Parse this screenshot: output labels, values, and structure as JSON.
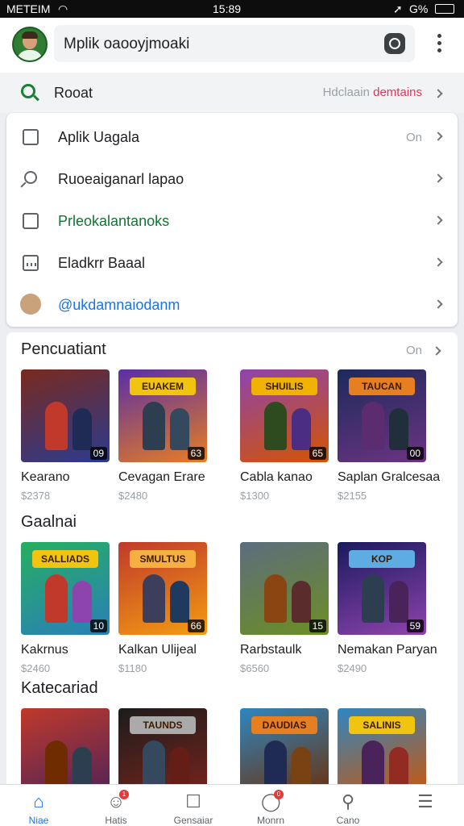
{
  "status_bar": {
    "carrier": "METEIM",
    "time": "15:89",
    "battery": "G%"
  },
  "app_bar": {
    "search_text": "Mplik oaooyjmoaki"
  },
  "recent": {
    "label": "Rooat",
    "side_gray": "Hdclaain",
    "side_red": "demtains"
  },
  "menu": [
    {
      "label": "Aplik Uagala",
      "side": "On",
      "icon": "apps-icon",
      "color": "#202124"
    },
    {
      "label": "Ruoeaiganarl lapao",
      "side": "",
      "icon": "search-icon",
      "color": "#202124"
    },
    {
      "label": "Prleokalantanoks",
      "side": "",
      "icon": "download-icon",
      "color": "#137333"
    },
    {
      "label": "Eladkrr Baaal",
      "side": "",
      "icon": "calendar-icon",
      "color": "#202124"
    },
    {
      "label": "@ukdamnaiodanm",
      "side": "",
      "icon": "person-icon",
      "color": "#1a73e8"
    }
  ],
  "sections": [
    {
      "title": "Pencuatiant",
      "more": "On",
      "cards": [
        {
          "name": "Kearano",
          "price": "$2378",
          "rating": "09",
          "banner": "",
          "bg": "#7a2a1f",
          "bg2": "#2b3b8f",
          "hero": "#c0392b",
          "hero2": "#1f2a55",
          "banner_color": "#e0a020"
        },
        {
          "name": "Cevagan Erare",
          "price": "$2480",
          "rating": "63",
          "banner": "EUAKEM",
          "bg": "#5a2ea6",
          "bg2": "#e67e22",
          "hero": "#2c3e50",
          "hero2": "#34495e",
          "banner_color": "#f1c40f"
        },
        {
          "name": "Cabla kanao",
          "price": "$1300",
          "rating": "65",
          "banner": "SHUILIS",
          "bg": "#8e44ad",
          "bg2": "#d35400",
          "hero": "#2e4a1f",
          "hero2": "#4b2e83",
          "banner_color": "#f0b400"
        },
        {
          "name": "Saplan Gralcesaa",
          "price": "$2155",
          "rating": "00",
          "banner": "TAUCAN",
          "bg": "#1c2a5a",
          "bg2": "#6c3483",
          "hero": "#5b2c6f",
          "hero2": "#212f3d",
          "banner_color": "#e67e22"
        }
      ]
    },
    {
      "title": "Gaalnai",
      "more": "",
      "cards": [
        {
          "name": "Kakrnus",
          "price": "$2460",
          "rating": "10",
          "banner": "SALLIADS",
          "bg": "#27ae60",
          "bg2": "#2980b9",
          "hero": "#c0392b",
          "hero2": "#8e44ad",
          "banner_color": "#f1c40f"
        },
        {
          "name": "Kalkan Ulijeal",
          "price": "$1180",
          "rating": "66",
          "banner": "SMULTUS",
          "bg": "#c0392b",
          "bg2": "#f39c12",
          "hero": "#3d3d5c",
          "hero2": "#1f3a5f",
          "banner_color": "#f5b041"
        },
        {
          "name": "Rarbstaulk",
          "price": "$6560",
          "rating": "15",
          "banner": "",
          "bg": "#5d6d7e",
          "bg2": "#6b8e23",
          "hero": "#8b4513",
          "hero2": "#5b2c2c",
          "banner_color": "#f0b400"
        },
        {
          "name": "Nemakan Paryan",
          "price": "$2490",
          "rating": "59",
          "banner": "KOP",
          "bg": "#1a1a5e",
          "bg2": "#8e44ad",
          "hero": "#2c3e50",
          "hero2": "#4a235a",
          "banner_color": "#5dade2"
        }
      ]
    },
    {
      "title": "Katecariad",
      "more": "",
      "cards": [
        {
          "name": "",
          "price": "",
          "rating": "",
          "banner": "",
          "bg": "#c0392b",
          "bg2": "#4a235a",
          "hero": "#6e2c00",
          "hero2": "#2c3e50",
          "banner_color": "#f0b400"
        },
        {
          "name": "",
          "price": "",
          "rating": "",
          "banner": "TAUNDS",
          "bg": "#1c1c1c",
          "bg2": "#7b241c",
          "hero": "#34495e",
          "hero2": "#641e16",
          "banner_color": "#aaaaaa"
        },
        {
          "name": "",
          "price": "",
          "rating": "",
          "banner": "DAUDIAS",
          "bg": "#2e86c1",
          "bg2": "#6e2c00",
          "hero": "#1f2a55",
          "hero2": "#784212",
          "banner_color": "#e67e22"
        },
        {
          "name": "",
          "price": "",
          "rating": "",
          "banner": "SALINIS",
          "bg": "#2e86c1",
          "bg2": "#d35400",
          "hero": "#4a235a",
          "hero2": "#922b21",
          "banner_color": "#f1c40f"
        }
      ]
    }
  ],
  "bottom_nav": [
    {
      "label": "Niae",
      "icon": "home-icon",
      "badge": "",
      "active": true
    },
    {
      "label": "Hatis",
      "icon": "games-icon",
      "badge": "1",
      "active": false
    },
    {
      "label": "Gensaiar",
      "icon": "document-icon",
      "badge": "",
      "active": false
    },
    {
      "label": "Monrn",
      "icon": "chat-icon",
      "badge": "0",
      "active": false
    },
    {
      "label": "Cano",
      "icon": "search-icon",
      "badge": "",
      "active": false
    },
    {
      "label": "",
      "icon": "menu-icon",
      "badge": "",
      "active": false
    }
  ]
}
